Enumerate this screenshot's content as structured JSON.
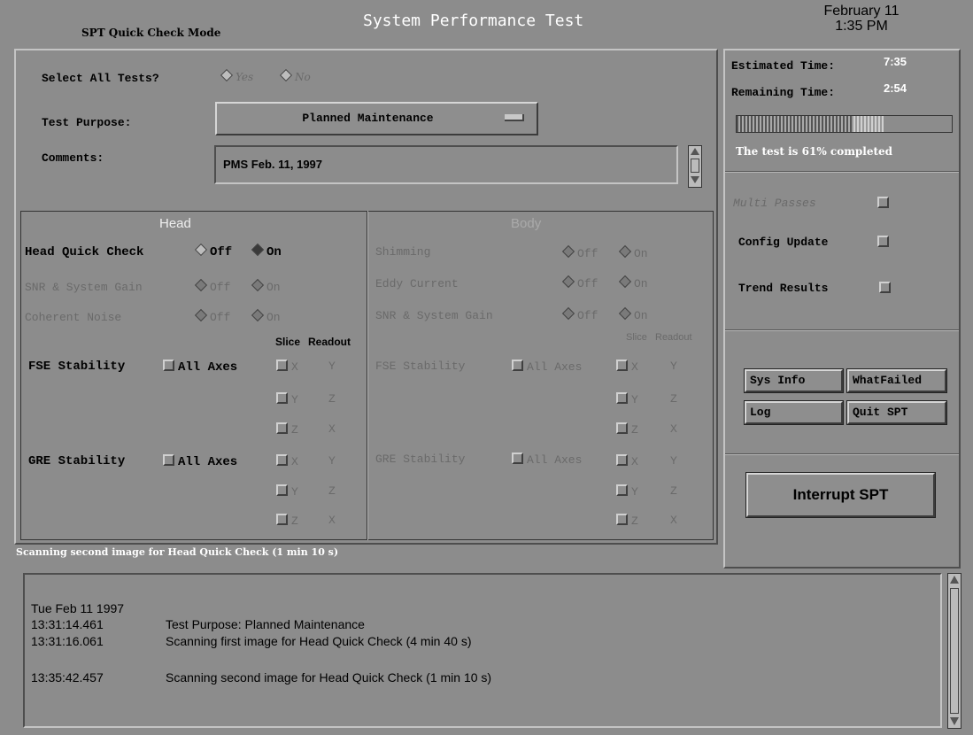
{
  "header": {
    "mode": "SPT Quick Check Mode",
    "title": "System Performance Test",
    "date": "February 11",
    "time": "1:35 PM"
  },
  "form": {
    "select_all_label": "Select All Tests?",
    "yes": "Yes",
    "no": "No",
    "purpose_label": "Test Purpose:",
    "purpose_value": "Planned Maintenance",
    "comments_label": "Comments:",
    "comments_value": "PMS Feb. 11, 1997"
  },
  "head": {
    "title": "Head",
    "quick_check": "Head Quick Check",
    "snr": "SNR & System Gain",
    "noise": "Coherent Noise",
    "off": "Off",
    "on": "On",
    "slice": "Slice",
    "readout": "Readout",
    "fse": "FSE Stability",
    "gre": "GRE Stability",
    "all_axes": "All Axes",
    "axes": [
      [
        "X",
        "Y"
      ],
      [
        "Y",
        "Z"
      ],
      [
        "Z",
        "X"
      ]
    ]
  },
  "body": {
    "title": "Body",
    "shimming": "Shimming",
    "eddy": "Eddy Current",
    "snr": "SNR & System Gain",
    "off": "Off",
    "on": "On",
    "slice": "Slice",
    "readout": "Readout",
    "fse": "FSE Stability",
    "gre": "GRE Stability",
    "all_axes": "All Axes"
  },
  "status": {
    "estimated_label": "Estimated Time:",
    "estimated_value": "7:35",
    "remaining_label": "Remaining Time:",
    "remaining_value": "2:54",
    "progress": 0.61,
    "progress_text": "The test is 61% completed"
  },
  "options": {
    "multi_passes": "Multi Passes",
    "config_update": "Config Update",
    "trend_results": "Trend Results"
  },
  "buttons": {
    "sys_info": "Sys Info",
    "what_failed": "WhatFailed",
    "log": "Log",
    "quit": "Quit SPT",
    "interrupt": "Interrupt SPT"
  },
  "scan_status": "Scanning second image for Head Quick Check (1 min 10 s)",
  "log": {
    "date": "Tue Feb 11 1997",
    "entries": [
      {
        "time": "13:31:14.461",
        "text": "Test Purpose: Planned Maintenance"
      },
      {
        "time": "13:31:16.061",
        "text": "Scanning first image for Head Quick Check (4 min 40 s)"
      },
      {
        "time": "13:35:42.457",
        "text": "Scanning second image for Head Quick Check (1 min 10 s)"
      }
    ]
  }
}
